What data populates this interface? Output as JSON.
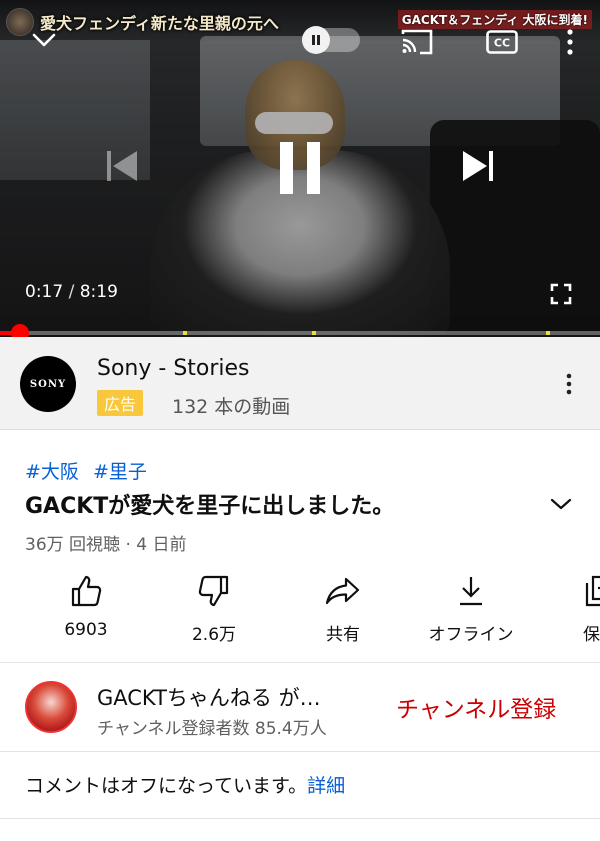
{
  "player": {
    "overlay_title_left": "愛犬フェンディ新たな里親の元へ",
    "overlay_title_right": "GACKT＆フェンディ 大阪に到着!",
    "time_current": "0:17",
    "time_separator": "/",
    "time_total": "8:19",
    "progress": 0.033,
    "chapter_marks": [
      0.305,
      0.52,
      0.91
    ]
  },
  "ad": {
    "logo_text": "SONY",
    "name": "Sony - Stories",
    "badge": "広告",
    "video_count": "132 本の動画"
  },
  "video": {
    "hashtags": [
      "#大阪",
      "#里子"
    ],
    "title": "GACKTが愛犬を里子に出しました。",
    "meta": "36万 回視聴 · 4 日前"
  },
  "actions": {
    "like": "6903",
    "dislike": "2.6万",
    "share": "共有",
    "offline": "オフライン",
    "save": "保存"
  },
  "channel": {
    "name": "GACKTちゃんねる が…",
    "subscribers": "チャンネル登録者数 85.4万人",
    "subscribe_label": "チャンネル登録"
  },
  "comments": {
    "off_text": "コメントはオフになっています。",
    "details_link": "詳細"
  },
  "colors": {
    "accent_red": "#ff0000",
    "subscribe_red": "#cc0000",
    "link_blue": "#065fd4",
    "ad_badge": "#f8c73b"
  }
}
